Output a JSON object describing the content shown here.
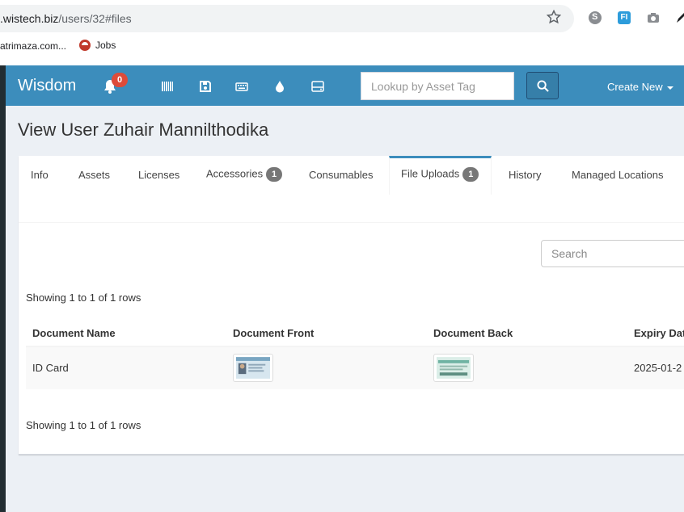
{
  "browser": {
    "url_host": ".wistech.biz",
    "url_path": "/users/32#files",
    "bookmarks": [
      "atrimaza.com...",
      "Jobs"
    ],
    "extensions": [
      "star-icon",
      "skype-icon",
      "fi-icon",
      "camera-icon",
      "pen-icon"
    ],
    "fi_label": "FI"
  },
  "header": {
    "brand": "Wisdom",
    "notification_count": "0",
    "nav_icons": [
      "barcode-icon",
      "save-icon",
      "keyboard-icon",
      "droplet-icon",
      "hdd-icon"
    ],
    "search_placeholder": "Lookup by Asset Tag",
    "create_new": "Create New"
  },
  "page": {
    "title": "View User Zuhair Mannilthodika"
  },
  "tabs": [
    {
      "label": "Info"
    },
    {
      "label": "Assets"
    },
    {
      "label": "Licenses"
    },
    {
      "label": "Accessories",
      "badge": "1"
    },
    {
      "label": "Consumables"
    },
    {
      "label": "File Uploads",
      "badge": "1",
      "active": true
    },
    {
      "label": "History"
    },
    {
      "label": "Managed Locations"
    }
  ],
  "table": {
    "search_placeholder": "Search",
    "showing_top": "Showing 1 to 1 of 1 rows",
    "showing_bottom": "Showing 1 to 1 of 1 rows",
    "columns": [
      "Document Name",
      "Document Front",
      "Document Back",
      "Expiry Dat"
    ],
    "rows": [
      {
        "name": "ID Card",
        "expiry": "2025-01-2"
      }
    ]
  },
  "colors": {
    "header": "#3c8dbc",
    "header_button": "#367fa9",
    "badge_red": "#dd4b39",
    "tab_badge": "#777777",
    "active_tab_border": "#3c8dbc",
    "page_bg": "#ecf0f5"
  }
}
